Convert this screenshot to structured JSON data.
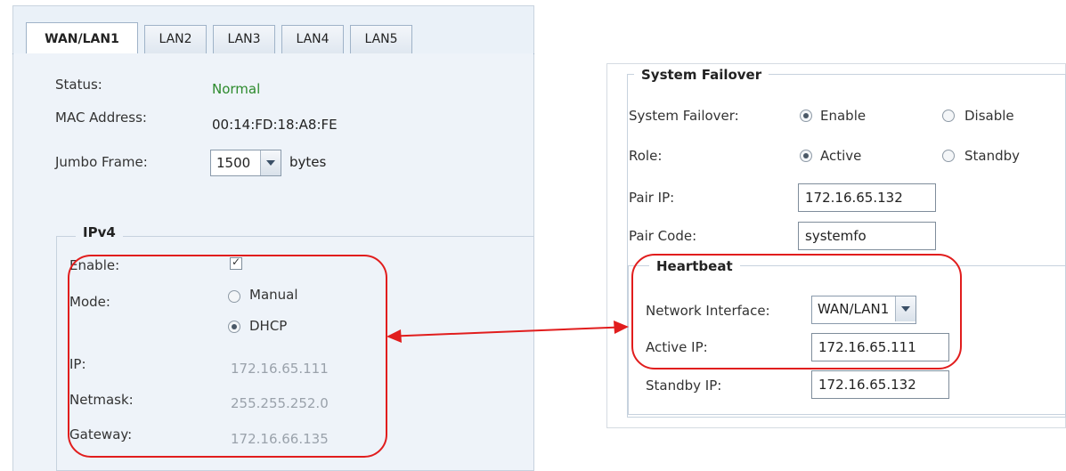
{
  "tabs": [
    "WAN/LAN1",
    "LAN2",
    "LAN3",
    "LAN4",
    "LAN5"
  ],
  "left": {
    "status_label": "Status:",
    "status_value": "Normal",
    "mac_label": "MAC Address:",
    "mac_value": "00:14:FD:18:A8:FE",
    "jumbo_label": "Jumbo Frame:",
    "jumbo_value": "1500",
    "jumbo_unit": "bytes",
    "ipv4": {
      "legend": "IPv4",
      "enable_label": "Enable:",
      "enable_checked": true,
      "mode_label": "Mode:",
      "mode_manual": "Manual",
      "mode_dhcp": "DHCP",
      "mode_selected": "DHCP",
      "ip_label": "IP:",
      "ip_value": "172.16.65.111",
      "netmask_label": "Netmask:",
      "netmask_value": "255.255.252.0",
      "gateway_label": "Gateway:",
      "gateway_value": "172.16.66.135"
    }
  },
  "right": {
    "legend": "System Failover",
    "failover_label": "System Failover:",
    "failover_enable": "Enable",
    "failover_disable": "Disable",
    "failover_selected": "Enable",
    "role_label": "Role:",
    "role_active": "Active",
    "role_standby": "Standby",
    "role_selected": "Active",
    "pair_ip_label": "Pair IP:",
    "pair_ip_value": "172.16.65.132",
    "pair_code_label": "Pair Code:",
    "pair_code_value": "systemfo",
    "heartbeat": {
      "legend": "Heartbeat",
      "netif_label": "Network Interface:",
      "netif_value": "WAN/LAN1",
      "active_ip_label": "Active IP:",
      "active_ip_value": "172.16.65.111",
      "standby_ip_label": "Standby IP:",
      "standby_ip_value": "172.16.65.132"
    }
  },
  "colors": {
    "highlight": "#e11d1d",
    "status_ok": "#2c8a2c",
    "panel_bg": "#eef3f9"
  }
}
